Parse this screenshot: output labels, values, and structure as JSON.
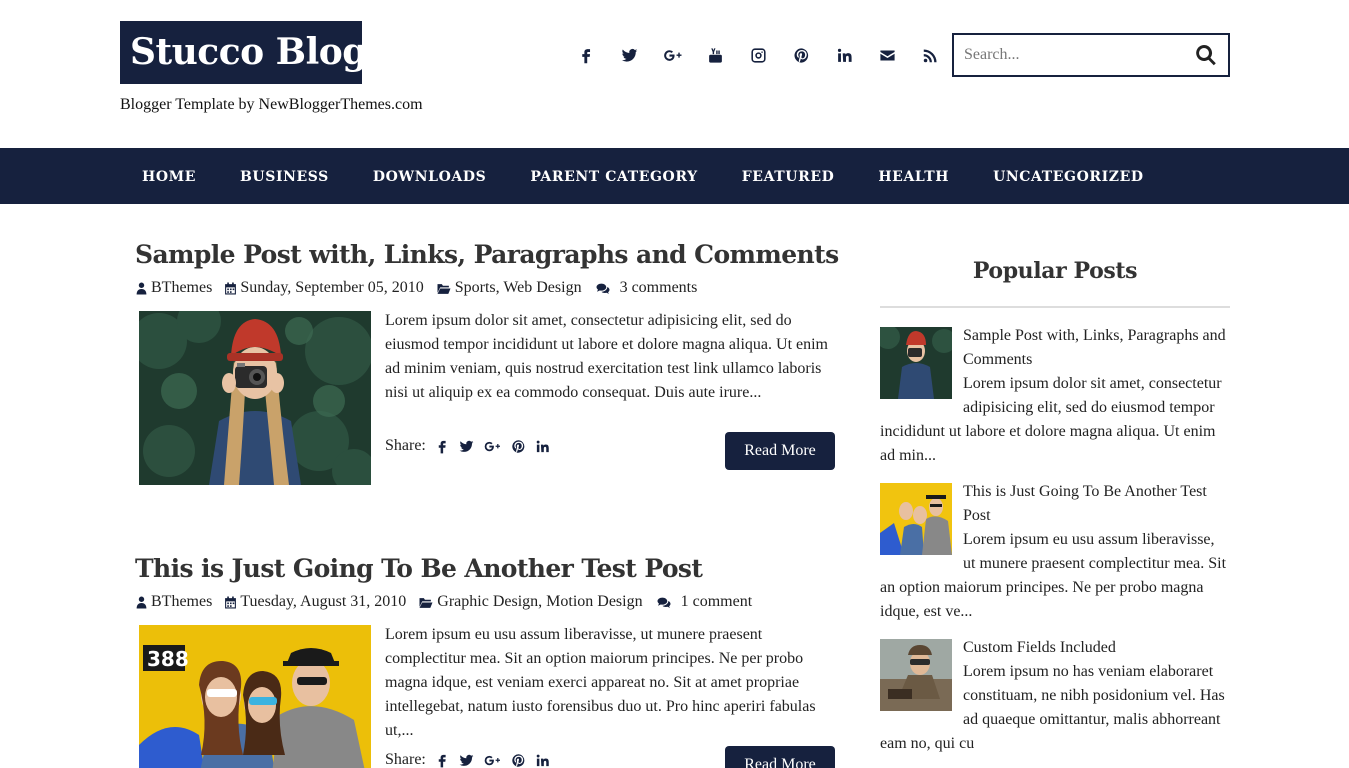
{
  "header": {
    "logo": "Stucco Blog",
    "tagline": "Blogger Template by NewBloggerThemes.com",
    "social": [
      "facebook-icon",
      "twitter-icon",
      "google-plus-icon",
      "youtube-icon",
      "instagram-icon",
      "pinterest-icon",
      "linkedin-icon",
      "email-icon",
      "rss-icon"
    ],
    "search_placeholder": "Search..."
  },
  "nav": {
    "items": [
      "HOME",
      "BUSINESS",
      "DOWNLOADS",
      "PARENT CATEGORY",
      "FEATURED",
      "HEALTH",
      "UNCATEGORIZED"
    ]
  },
  "posts": [
    {
      "title": "Sample Post with, Links, Paragraphs and Comments",
      "author": "BThemes",
      "date": "Sunday, September 05, 2010",
      "categories": "Sports, Web Design",
      "comments": "3 comments",
      "excerpt": "Lorem ipsum dolor sit amet, consectetur adipisicing elit, sed do eiusmod tempor incididunt ut labore et dolore magna aliqua. Ut enim ad minim veniam, quis nostrud exercitation test link ullamco laboris nisi ut aliquip ex ea commodo consequat. Duis aute irure...",
      "share_label": "Share:",
      "read_more": "Read More"
    },
    {
      "title": "This is Just Going To Be Another Test Post",
      "author": "BThemes",
      "date": "Tuesday, August 31, 2010",
      "categories": "Graphic Design, Motion Design",
      "comments": "1 comment",
      "excerpt": "Lorem ipsum eu usu assum liberavisse, ut munere praesent complectitur mea. Sit an option maiorum principes. Ne per probo magna idque, est veniam exerci appareat no. Sit at amet propriae intellegebat, natum iusto forensibus duo ut. Pro hinc aperiri fabulas ut,...",
      "share_label": "Share:",
      "read_more": "Read More",
      "badge": "388"
    }
  ],
  "sidebar": {
    "title": "Popular Posts",
    "items": [
      {
        "title": "Sample Post with, Links, Paragraphs and Comments",
        "excerpt": "Lorem ipsum dolor sit amet, consectetur adipisicing elit, sed do eiusmod tempor incididunt ut labore et dolore magna aliqua. Ut enim ad min..."
      },
      {
        "title": "This is Just Going To Be Another Test Post",
        "excerpt": "Lorem ipsum eu usu assum liberavisse, ut munere praesent complectitur mea. Sit an option maiorum principes. Ne per probo magna idque, est ve..."
      },
      {
        "title": "Custom Fields Included",
        "excerpt": "Lorem ipsum no has veniam elaboraret constituam, ne nibh posidonium vel. Has ad quaeque omittantur, malis abhorreant eam no, qui cu"
      }
    ]
  },
  "colors": {
    "brand": "#16213e"
  }
}
